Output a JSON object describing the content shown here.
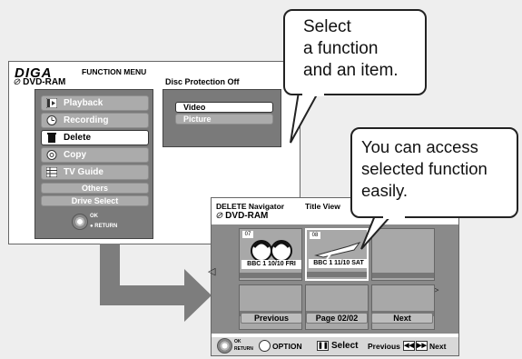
{
  "menu_screen": {
    "brand": "DIGA",
    "title": "FUNCTION MENU",
    "media": "DVD-RAM",
    "disc_status": "Disc Protection Off",
    "items": [
      {
        "label": "Playback",
        "icon": "playback-icon"
      },
      {
        "label": "Recording",
        "icon": "clock-icon"
      },
      {
        "label": "Delete",
        "icon": "trash-icon"
      },
      {
        "label": "Copy",
        "icon": "copy-icon"
      },
      {
        "label": "TV Guide",
        "icon": "tv-guide-icon"
      }
    ],
    "extra_items": [
      "Others",
      "Drive Select"
    ],
    "selected": "Delete",
    "sub_items": [
      "Video",
      "Picture"
    ],
    "ok_label": "OK",
    "return_label": "RETURN"
  },
  "callouts": {
    "top": "Select\na function\nand an item.",
    "right": "You can access\nselected function\neasily."
  },
  "nav_screen": {
    "title": "DELETE Navigator",
    "view": "Title View",
    "media": "DVD-RAM",
    "thumbs": [
      {
        "num": "07",
        "caption": "BBC 1 10/10 FRI"
      },
      {
        "num": "08",
        "caption": "BBC 1 11/10 SAT"
      }
    ],
    "previous_label": "Previous",
    "page_label": "Page 02/02",
    "next_label": "Next",
    "footer": {
      "ok": "OK",
      "return": "RETURN",
      "option": "OPTION",
      "select": "Select",
      "previous": "Previous",
      "next": "Next"
    }
  }
}
